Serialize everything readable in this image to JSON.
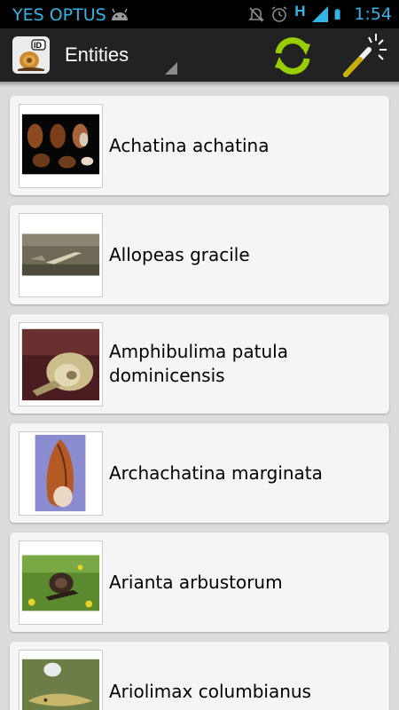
{
  "status_bar": {
    "carrier": "YES OPTUS",
    "time": "1:54",
    "network_type": "H",
    "icons": [
      "android-icon",
      "mute-icon",
      "alarm-icon",
      "network-h-icon",
      "signal-icon",
      "battery-icon"
    ]
  },
  "action_bar": {
    "title": "Entities",
    "icons": [
      "app-snail-id-icon",
      "refresh-icon",
      "magic-wand-icon"
    ],
    "accent_color": "#9acd00"
  },
  "entities": [
    {
      "name": "Achatina achatina",
      "image": "achatina-achatina-photo"
    },
    {
      "name": "Allopeas gracile",
      "image": "allopeas-gracile-photo"
    },
    {
      "name": "Amphibulima patula dominicensis",
      "image": "amphibulima-patula-photo"
    },
    {
      "name": "Archachatina marginata",
      "image": "archachatina-marginata-photo"
    },
    {
      "name": "Arianta arbustorum",
      "image": "arianta-arbustorum-photo"
    },
    {
      "name": "Ariolimax columbianus",
      "image": "ariolimax-columbianus-photo"
    }
  ]
}
